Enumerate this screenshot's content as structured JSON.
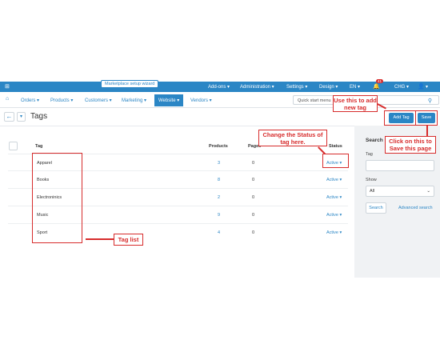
{
  "topbar": {
    "wizard": "Marketplace setup wizard",
    "addons": "Add-ons ▾",
    "administration": "Administration ▾",
    "settings": "Settings ▾",
    "design": "Design ▾",
    "lang": "EN ▾",
    "notif_count": "41",
    "currency": "CHG ▾",
    "user": "▾"
  },
  "nav": {
    "orders": "Orders ▾",
    "products": "Products ▾",
    "customers": "Customers ▾",
    "marketing": "Marketing ▾",
    "website": "Website ▾",
    "vendors": "Vendors ▾",
    "quick_start": "Quick start menu"
  },
  "page": {
    "title": "Tags"
  },
  "toolbar": {
    "add_tag": "Add Tag",
    "save": "Save"
  },
  "table": {
    "headers": {
      "tag": "Tag",
      "products": "Products",
      "pages": "Pages",
      "status": "Status"
    },
    "rows": [
      {
        "tag": "Apparel",
        "products": "3",
        "pages": "0",
        "status": "Active ▾"
      },
      {
        "tag": "Books",
        "products": "8",
        "pages": "0",
        "status": "Active ▾"
      },
      {
        "tag": "Electroninics",
        "products": "2",
        "pages": "0",
        "status": "Active ▾"
      },
      {
        "tag": "Music",
        "products": "9",
        "pages": "0",
        "status": "Active ▾"
      },
      {
        "tag": "Sport",
        "products": "4",
        "pages": "0",
        "status": "Active ▾"
      }
    ]
  },
  "sidebar": {
    "title": "Search",
    "tag_label": "Tag",
    "show_label": "Show",
    "show_value": "All",
    "search_button": "Search",
    "advanced_search": "Advanced search"
  },
  "annotations": {
    "add_tag_note": "Use this to add new tag",
    "save_note": "Click on this to Save this page",
    "status_note": "Change the Status of tag here.",
    "tag_list_note": "Tag list"
  },
  "colors": {
    "accent": "#2b86c5",
    "annotation": "#d72c2c"
  }
}
